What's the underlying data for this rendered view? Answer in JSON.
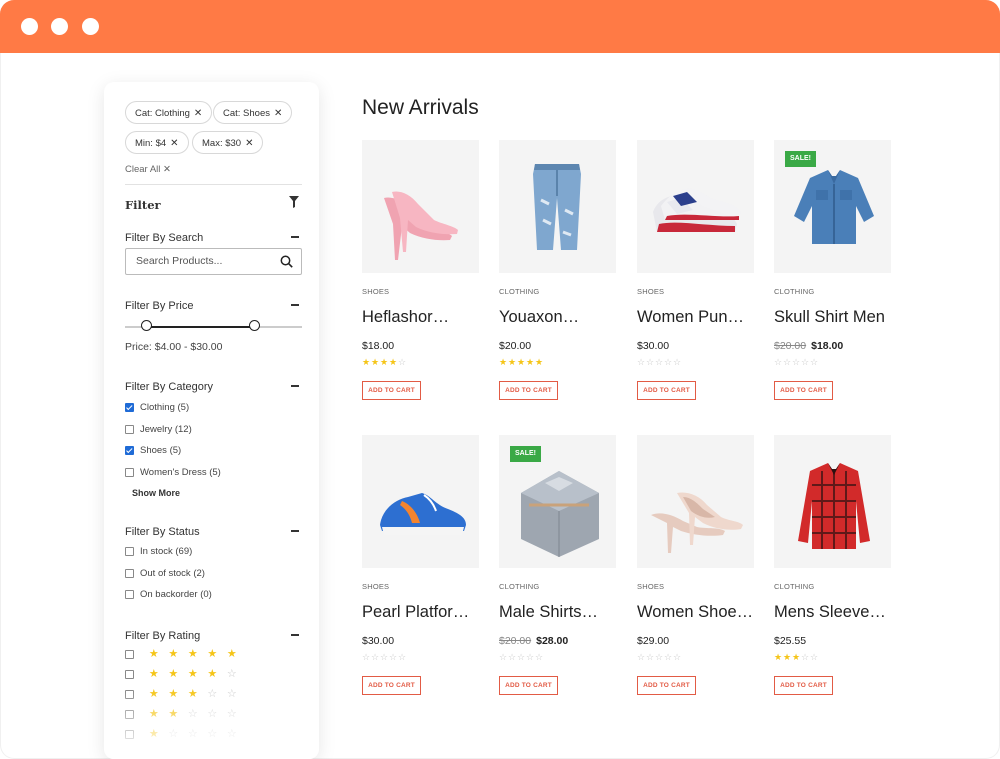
{
  "window": {
    "accent": "#ff7a45"
  },
  "filters": {
    "chips": [
      {
        "label": "Cat: Clothing",
        "remove": "✕"
      },
      {
        "label": "Cat: Shoes",
        "remove": "✕"
      },
      {
        "label": "Min: $4",
        "remove": "✕"
      },
      {
        "label": "Max: $30",
        "remove": "✕"
      }
    ],
    "clear_all": "Clear All",
    "clear_icon": "✕",
    "title": "Filter",
    "search": {
      "heading": "Filter By Search",
      "placeholder": "Search Products..."
    },
    "price": {
      "heading": "Filter By Price",
      "text": "Price: $4.00 - $30.00",
      "slider_min_fraction": 0.12,
      "slider_max_fraction": 0.73
    },
    "category": {
      "heading": "Filter By Category",
      "items": [
        {
          "label": "Clothing (5)",
          "checked": true
        },
        {
          "label": "Jewelry (12)",
          "checked": false
        },
        {
          "label": "Shoes (5)",
          "checked": true
        },
        {
          "label": "Women's Dress (5)",
          "checked": false
        }
      ],
      "show_more": "Show More"
    },
    "status": {
      "heading": "Filter By Status",
      "items": [
        {
          "label": "In stock (69)",
          "checked": false
        },
        {
          "label": "Out of stock (2)",
          "checked": false
        },
        {
          "label": "On backorder (0)",
          "checked": false
        }
      ]
    },
    "rating": {
      "heading": "Filter By Rating",
      "rows": [
        5,
        4,
        3,
        2,
        1
      ]
    }
  },
  "main": {
    "title": "New Arrivals",
    "cart_label": "ADD TO CART",
    "sale_label": "SALE!",
    "products": [
      {
        "category": "SHOES",
        "name": "Heflashor…",
        "price": "$18.00",
        "old_price": "",
        "rating": 4,
        "sale": false,
        "image": "pink-heels"
      },
      {
        "category": "CLOTHING",
        "name": "Youaxon…",
        "price": "$20.00",
        "old_price": "",
        "rating": 5,
        "sale": false,
        "image": "jeans"
      },
      {
        "category": "SHOES",
        "name": "Women Pun…",
        "price": "$30.00",
        "old_price": "",
        "rating": 0,
        "sale": false,
        "image": "sneakers"
      },
      {
        "category": "CLOTHING",
        "name": "Skull Shirt Men",
        "price": "$18.00",
        "old_price": "$20.00",
        "rating": 0,
        "sale": true,
        "image": "denim-shirt"
      },
      {
        "category": "SHOES",
        "name": "Pearl Platfor…",
        "price": "$30.00",
        "old_price": "",
        "rating": 0,
        "sale": false,
        "image": "blue-sneaker"
      },
      {
        "category": "CLOTHING",
        "name": "Male Shirts…",
        "price": "$28.00",
        "old_price": "$20.00",
        "rating": 0,
        "sale": true,
        "image": "folded-shirt"
      },
      {
        "category": "SHOES",
        "name": "Women Shoe…",
        "price": "$29.00",
        "old_price": "",
        "rating": 0,
        "sale": false,
        "image": "beige-heels"
      },
      {
        "category": "CLOTHING",
        "name": "Mens Sleeve…",
        "price": "$25.55",
        "old_price": "",
        "rating": 3,
        "sale": false,
        "image": "plaid-shirt"
      }
    ]
  }
}
